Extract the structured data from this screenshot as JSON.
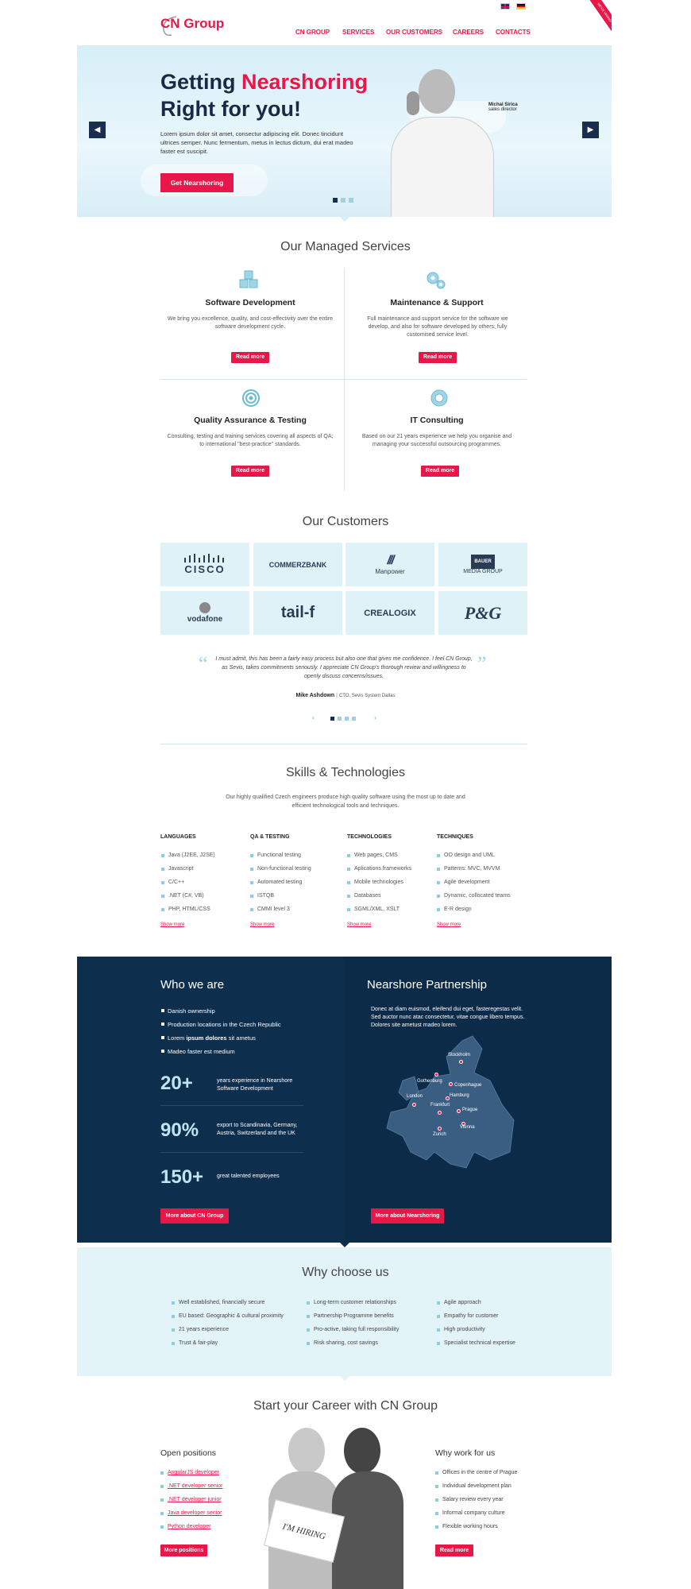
{
  "header": {
    "logo": "CN Group",
    "flags": [
      "en-flag-icon",
      "de-flag-icon"
    ],
    "ribbon": "WE'RE HIRING!",
    "nav": [
      "CN GROUP",
      "SERVICES",
      "OUR CUSTOMERS",
      "CAREERS",
      "CONTACTS"
    ]
  },
  "hero": {
    "title_part1": "Getting ",
    "title_highlight": "Nearshoring",
    "title_line2": "Right for you!",
    "text": "Lorem ipsum dolor sit amet, consectur adipiscing elit. Donec tincidunt ultrices semper. Nunc fermentum, metus in lectus dictum, dui erat madeo faster est suscipit.",
    "cta": "Get Nearshoring",
    "person_name": "Michal Sirica",
    "person_role": "sales director",
    "slides": 3,
    "active_slide": 1
  },
  "services": {
    "title": "Our Managed Services",
    "items": [
      {
        "title": "Software Development",
        "text": "We bring you excellence, quality, and cost-effectivity over the entire software development cycle.",
        "button": "Read more",
        "icon": "cubes-icon"
      },
      {
        "title": "Maintenance & Support",
        "text": "Full maintenance and support service for the software we develop, and also for software developed by others; fully customised service level.",
        "button": "Read more",
        "icon": "gears-icon"
      },
      {
        "title": "Quality Assurance & Testing",
        "text": "Consulting, testing and training services covering all aspects of QA; to international \"best-practice\" standards.",
        "button": "Read more",
        "icon": "target-icon"
      },
      {
        "title": "IT Consulting",
        "text": "Based on our 21 years experience we help you organise and managing your successful outsourcing programmes.",
        "button": "Read more",
        "icon": "lifebuoy-icon"
      }
    ]
  },
  "customers": {
    "title": "Our Customers",
    "logos": [
      "CISCO",
      "COMMERZBANK",
      "Manpower",
      "MEDIA GROUP",
      "vodafone",
      "tail-f",
      "CREALOGIX",
      "P&G"
    ],
    "bauer": "BAUER",
    "quote": "I must admit, this has been a fairly easy process but also one that gives me confidence. I feel CN Group, as Sevis, takes commitments seriously. I appreciate CN Group's thorough review and willingness to openly discuss concerns/issues.",
    "author": "Mike Ashdown",
    "author_role": "CTO, Sevis System Dallas",
    "slides": 4,
    "active_slide": 1
  },
  "skills": {
    "title": "Skills & Technologies",
    "intro": "Our highly qualified Czech engineers produce high quality software using the most up to date and efficient technological tools and techniques.",
    "show_more": "Show more",
    "columns": [
      {
        "head": "LANGUAGES",
        "items": [
          "Java (J2EE, J2SE)",
          "Javascript",
          "C/C++",
          ".NET (C#, VB)",
          "PHP, HTML/CSS"
        ]
      },
      {
        "head": "QA & TESTING",
        "items": [
          "Functional testing",
          "Non-functional testing",
          "Automated testing",
          "ISTQB",
          "CMMI level 3"
        ]
      },
      {
        "head": "TECHNOLOGIES",
        "items": [
          "Web pages, CMS",
          "Aplications frameworks",
          "Mobile technologies",
          "Databases",
          "SGML/XML, XSLT"
        ]
      },
      {
        "head": "TECHNIQUES",
        "items": [
          "OO design and UML",
          "Patterns: MVC, MVVM",
          "Agile development",
          "Dynamic, collocated teams",
          "E-R design"
        ]
      }
    ]
  },
  "who": {
    "title": "Who we are",
    "items": [
      "Danish ownership",
      "Production locations in the Czech Republic",
      "Madeo faster est medium"
    ],
    "item3_pre": "Lorem ",
    "item3_bold": "ipsum dolores",
    "item3_post": " sit ametus",
    "stats": [
      {
        "value": "20+",
        "text": "years experience in Nearshore Software Development"
      },
      {
        "value": "90%",
        "text": "export to Scandinavia, Germany, Austria, Switzerland and the UK"
      },
      {
        "value": "150+",
        "text": "great talented employees"
      }
    ],
    "button": "More about CN Group"
  },
  "partnership": {
    "title": "Nearshore Partnership",
    "text": "Donec at diam euismod, eleifend dui eget, fasteregestas velit. Sed auctor nunc atac consectetur, vitae congue libero tempus. Dolores site ametust madeo lorem.",
    "cities": [
      "Stockholm",
      "Gothenburg",
      "Copenhague",
      "Hamburg",
      "London",
      "Frankfurt",
      "Prague",
      "Vienna",
      "Zurich"
    ],
    "button": "More about Nearshoring"
  },
  "why": {
    "title": "Why choose us",
    "columns": [
      [
        "Well established, financially secure",
        "EU based: Geographic & cultural proximity",
        "21 years experience",
        "Trust & fair-play"
      ],
      [
        "Long-term customer relationships",
        "Partnership Programme benefits",
        "Pro-active, taking full responsibility",
        "Risk sharing, cost savings"
      ],
      [
        "Agile approach",
        "Empathy for customer",
        "High productivity",
        "Specialist technical expertise"
      ]
    ]
  },
  "career": {
    "title": "Start your Career with CN Group",
    "open_title": "Open positions",
    "positions": [
      "AngularJS developer",
      ".NET developer senior",
      ".NET developer junior",
      "Java developer senior",
      "Python developer"
    ],
    "more_positions": "More positions",
    "sign": "I'M HIRING",
    "why_title": "Why work for us",
    "why_items": [
      "Offices in the centre of Prague",
      "Individual development plan",
      "Salary review every year",
      "Informal company culture",
      "Flexible working hours"
    ],
    "read_more": "Read more"
  },
  "colors": {
    "accent": "#e8174a",
    "navy": "#0e2e4e",
    "light": "#dff2f7"
  }
}
